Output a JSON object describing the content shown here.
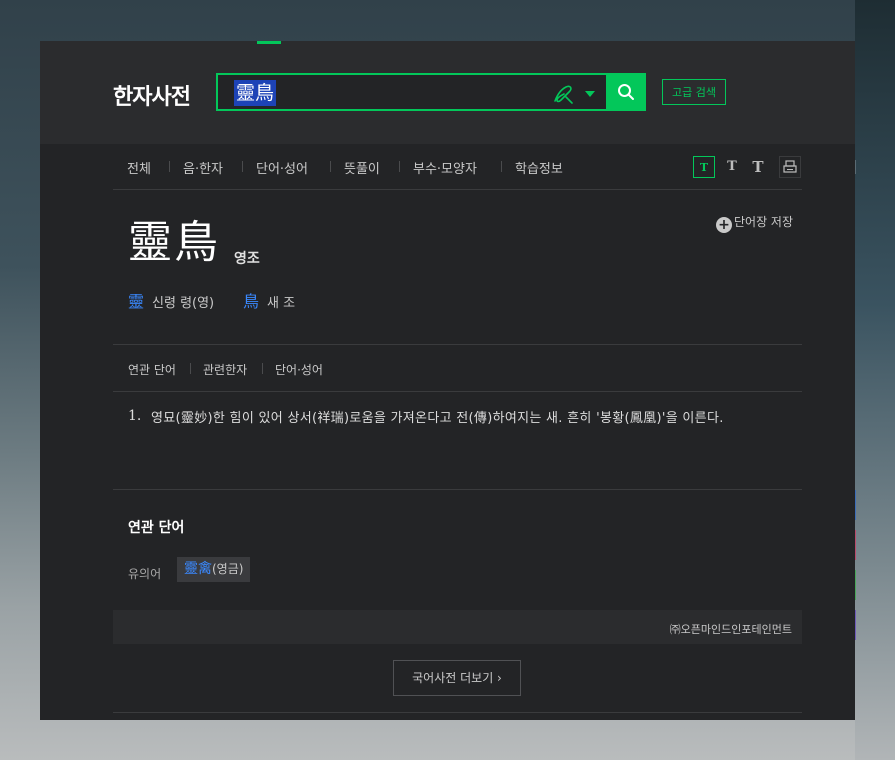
{
  "header": {
    "logo": "한자사전",
    "search_value": "靈鳥",
    "advanced_search": "고급 검색"
  },
  "tabs": [
    "전체",
    "음·한자",
    "단어·성어",
    "뜻풀이",
    "부수·모양자",
    "학습정보"
  ],
  "font_buttons": [
    "T",
    "T",
    "T"
  ],
  "entry": {
    "hanja": "靈鳥",
    "reading": "영조",
    "save_word": "단어장 저장",
    "chars": [
      {
        "hanja": "靈",
        "meaning": "신령 령(영)"
      },
      {
        "hanja": "鳥",
        "meaning": "새 조"
      }
    ]
  },
  "subtabs": [
    "연관 단어",
    "관련한자",
    "단어·성어"
  ],
  "definition": {
    "number": "1.",
    "text": "영묘(靈妙)한 힘이 있어 상서(祥瑞)로움을 가져온다고 전(傳)하여지는 새. 흔히 '봉황(鳳凰)'을 이른다."
  },
  "related": {
    "title": "연관 단어",
    "synonym_label": "유의어",
    "synonym_hanja": "靈禽",
    "synonym_reading": "(영금)"
  },
  "source": "㈜오픈마인드인포테인먼트",
  "more_button": "국어사전 더보기 ›",
  "colors": {
    "accent": "#03c75a",
    "link": "#3a89ff",
    "background": "#232426",
    "selection": "#1d43b6"
  }
}
